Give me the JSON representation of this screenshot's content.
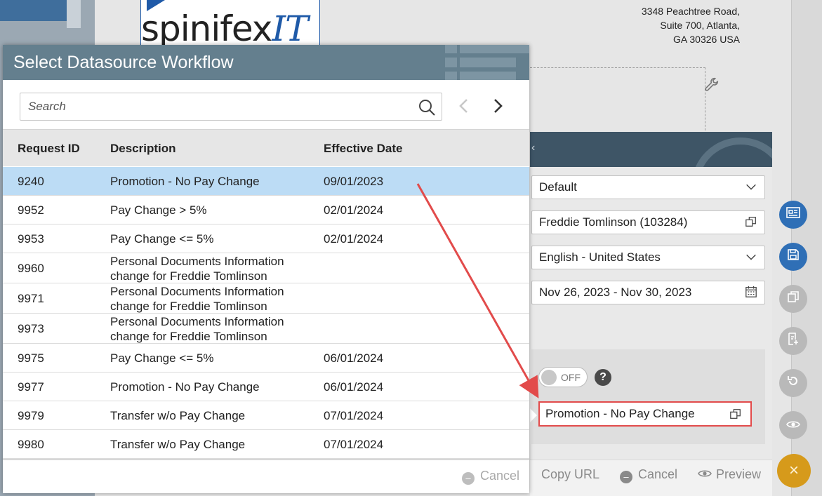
{
  "background": {
    "logo": {
      "main": "spinifex",
      "accent": "IT"
    },
    "address_lines": [
      "3348 Peachtree Road,",
      "Suite 700, Atlanta,",
      "GA 30326 USA"
    ],
    "form_fields": {
      "template": "Default",
      "employee": "Freddie Tomlinson (103284)",
      "language": "English - United States",
      "date_range": "Nov 26, 2023 - Nov 30, 2023",
      "toggle_label": "OFF",
      "help_glyph": "?",
      "workflow": "Promotion - No Pay Change"
    },
    "footer_actions": {
      "copy_url": "Copy URL",
      "cancel": "Cancel",
      "preview": "Preview"
    },
    "fab_close_glyph": "×"
  },
  "modal": {
    "title": "Select Datasource Workflow",
    "search": {
      "placeholder": "Search",
      "value": ""
    },
    "columns": {
      "request_id": "Request ID",
      "description": "Description",
      "effective_date": "Effective Date"
    },
    "rows": [
      {
        "id": "9240",
        "desc": "Promotion - No Pay Change",
        "date": "09/01/2023",
        "selected": true
      },
      {
        "id": "9952",
        "desc": "Pay Change > 5%",
        "date": "02/01/2024"
      },
      {
        "id": "9953",
        "desc": "Pay Change <= 5%",
        "date": "02/01/2024"
      },
      {
        "id": "9960",
        "desc": "Personal Documents Information change for Freddie Tomlinson",
        "date": ""
      },
      {
        "id": "9971",
        "desc": "Personal Documents Information change for Freddie Tomlinson",
        "date": ""
      },
      {
        "id": "9973",
        "desc": "Personal Documents Information change for Freddie Tomlinson",
        "date": ""
      },
      {
        "id": "9975",
        "desc": "Pay Change <= 5%",
        "date": "06/01/2024"
      },
      {
        "id": "9977",
        "desc": "Promotion - No Pay Change",
        "date": "06/01/2024"
      },
      {
        "id": "9979",
        "desc": "Transfer w/o Pay Change",
        "date": "07/01/2024"
      },
      {
        "id": "9980",
        "desc": "Transfer w/o Pay Change",
        "date": "07/01/2024"
      }
    ],
    "cancel_label": "Cancel"
  },
  "colors": {
    "modal_header": "#647f8e",
    "selected_row": "#bcdcf5",
    "annotation_red": "#e24b4b",
    "fab_blue": "#2f6fb6",
    "fab_gold": "#d69a1b"
  }
}
